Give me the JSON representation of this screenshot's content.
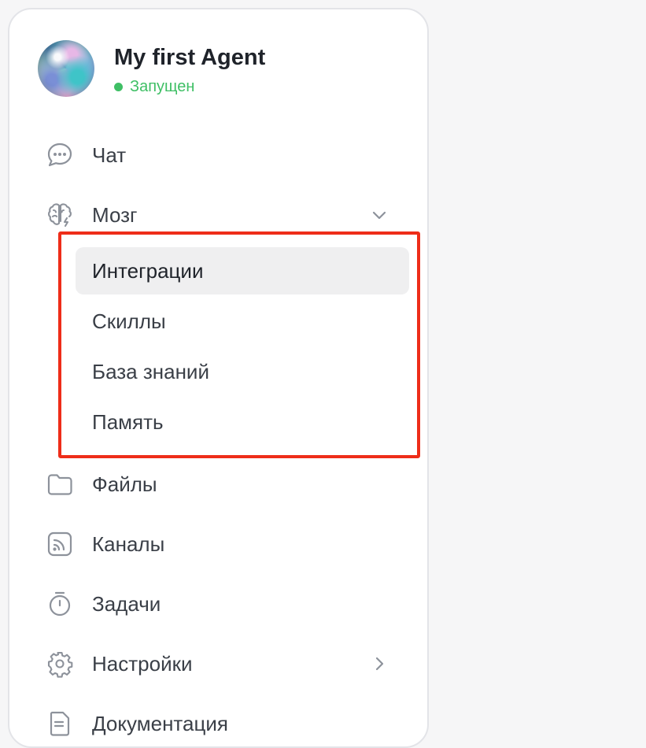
{
  "agent": {
    "name": "My first Agent",
    "status": "Запущен",
    "status_color": "#3fbf65"
  },
  "nav": {
    "chat": {
      "label": "Чат",
      "icon": "chat-bubble-icon"
    },
    "brain": {
      "label": "Мозг",
      "icon": "brain-icon",
      "expanded": true
    },
    "files": {
      "label": "Файлы",
      "icon": "folder-icon"
    },
    "channels": {
      "label": "Каналы",
      "icon": "rss-icon"
    },
    "tasks": {
      "label": "Задачи",
      "icon": "stopwatch-icon"
    },
    "settings": {
      "label": "Настройки",
      "icon": "gear-icon"
    },
    "docs": {
      "label": "Документация",
      "icon": "document-icon"
    }
  },
  "brain_submenu": [
    {
      "label": "Интеграции",
      "active": true
    },
    {
      "label": "Скиллы",
      "active": false
    },
    {
      "label": "База знаний",
      "active": false
    },
    {
      "label": "Память",
      "active": false
    }
  ],
  "colors": {
    "highlight_frame": "#ee2d19",
    "active_item_bg": "#efeff0"
  }
}
